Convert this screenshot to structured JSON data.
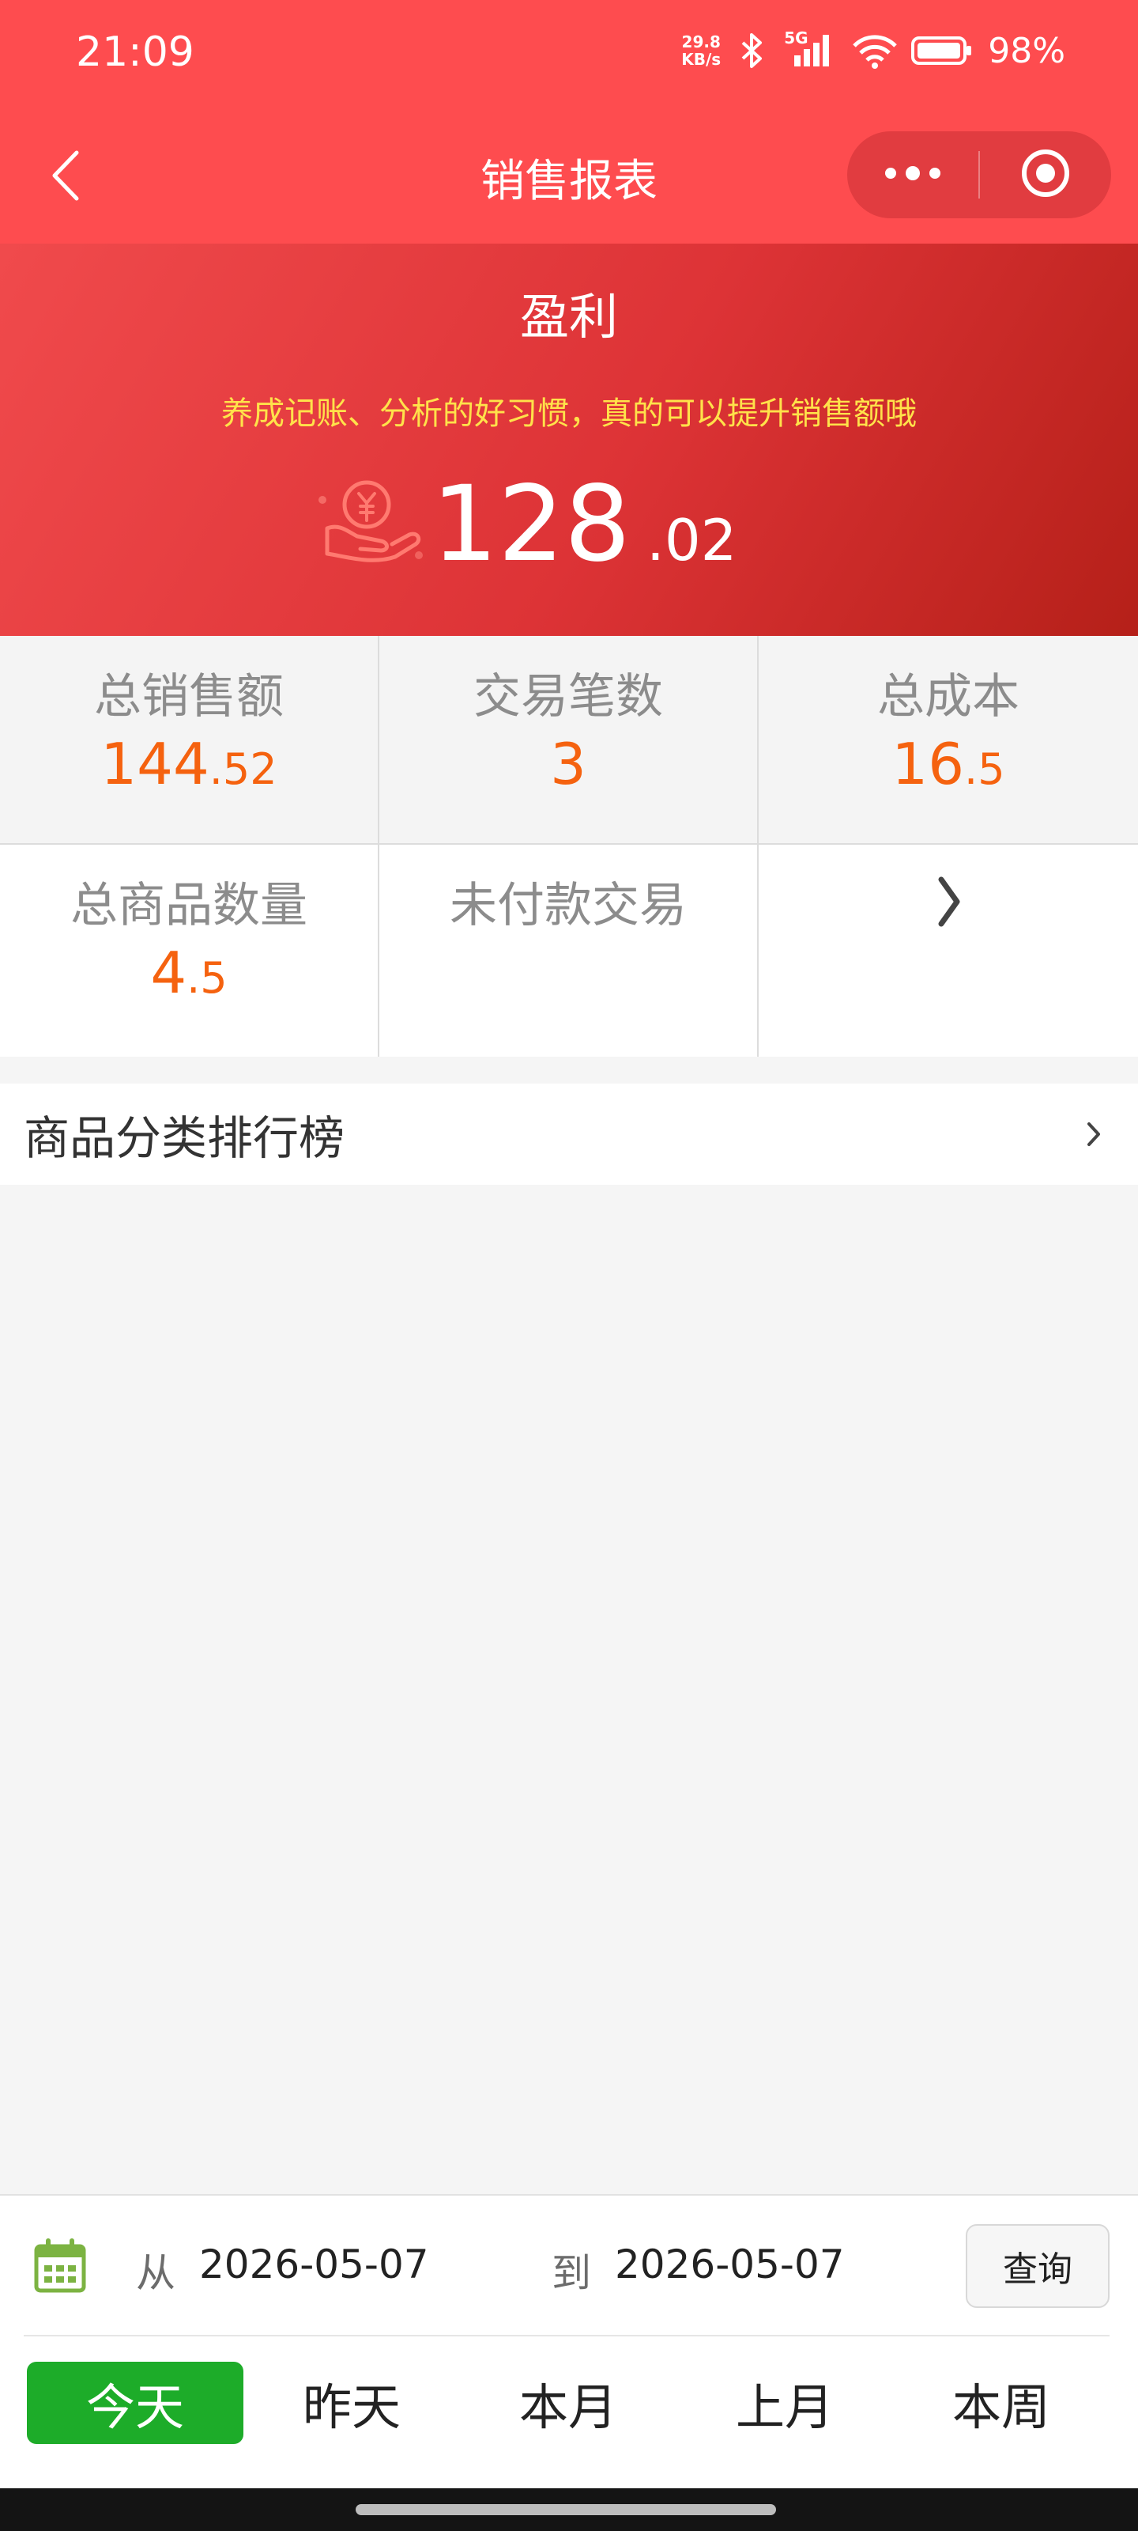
{
  "status_bar": {
    "time": "21:09",
    "net_speed_value": "29.8",
    "net_speed_unit": "KB/s",
    "network_type": "5G",
    "battery_percent": "98%",
    "icons": [
      "bluetooth-icon",
      "signal-icon",
      "wifi-icon",
      "battery-icon"
    ]
  },
  "nav": {
    "title": "销售报表",
    "back_icon": "chevron-left-icon",
    "more_icon": "more-dots-icon",
    "close_icon": "target-close-icon"
  },
  "hero": {
    "label": "盈利",
    "tip": "养成记账、分析的好习惯，真的可以提升销售额哦",
    "amount_int": "128",
    "amount_dec": ".02",
    "icon": "money-hand-icon"
  },
  "stats": {
    "row1": [
      {
        "label": "总销售额",
        "int": "144",
        "dec": ".52"
      },
      {
        "label": "交易笔数",
        "int": "3",
        "dec": ""
      },
      {
        "label": "总成本",
        "int": "16",
        "dec": ".5"
      }
    ],
    "row2": [
      {
        "label": "总商品数量",
        "int": "4",
        "dec": ".5"
      },
      {
        "label": "未付款交易",
        "int": "",
        "dec": ""
      }
    ],
    "more_icon": "chevron-right-icon"
  },
  "ranking": {
    "label": "商品分类排行榜",
    "chevron_icon": "chevron-right-icon"
  },
  "date_filter": {
    "from_label": "从",
    "from_value": "2026-05-07",
    "to_label": "到",
    "to_value": "2026-05-07",
    "query_label": "查询",
    "calendar_icon": "calendar-icon",
    "quick_ranges": [
      "今天",
      "昨天",
      "本月",
      "上月",
      "本周"
    ],
    "active_range": "今天"
  },
  "colors": {
    "header_red": "#fe4c4f",
    "accent_orange": "#f5620f",
    "tip_yellow": "#ffe24a",
    "active_green": "#1dac29"
  }
}
